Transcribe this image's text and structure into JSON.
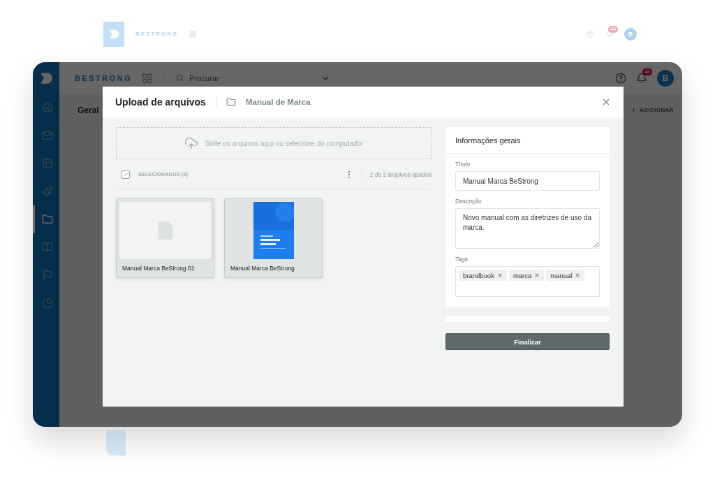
{
  "backdrop": {
    "brand": "BESTRONG",
    "notification_count": "44",
    "avatar": "B"
  },
  "app": {
    "brand": "BESTRONG",
    "search": {
      "placeholder": "Procurar"
    },
    "notification_count": "44",
    "avatar": "B",
    "sidebar": {
      "items": [
        {
          "selected": false
        },
        {
          "selected": false
        },
        {
          "selected": false
        },
        {
          "selected": false
        },
        {
          "selected": true
        },
        {
          "selected": false
        },
        {
          "selected": false
        },
        {
          "selected": false
        }
      ]
    },
    "page_title": "Geral",
    "add_button": "ADICIONAR"
  },
  "modal": {
    "title": "Upload de arquivos",
    "folder": "Manual de Marca",
    "dropzone": "Solte os arquivos aqui ou selecione do computador",
    "select_all": {
      "label": "SELECIONADOS (2)",
      "checked": true
    },
    "upload_status": "2 de 2 arquivos upados",
    "files": [
      {
        "name": "Manual Marca BeStrong 01",
        "kind": "file",
        "selected": true
      },
      {
        "name": "Manual Marca BeStrong",
        "kind": "picture",
        "selected": true
      }
    ],
    "info_panel": {
      "title": "Informações gerais",
      "fields": [
        {
          "label": "Título",
          "kind": "input",
          "value": "Manual Marca BeStrong"
        },
        {
          "label": "Descrição",
          "kind": "textarea",
          "value": "Novo manual com as diretrizes de uso da marca."
        },
        {
          "label": "Tags",
          "kind": "tags",
          "tags": [
            "brandbook",
            "marca",
            "manual"
          ]
        }
      ]
    },
    "finish_button": "Finalizar"
  }
}
